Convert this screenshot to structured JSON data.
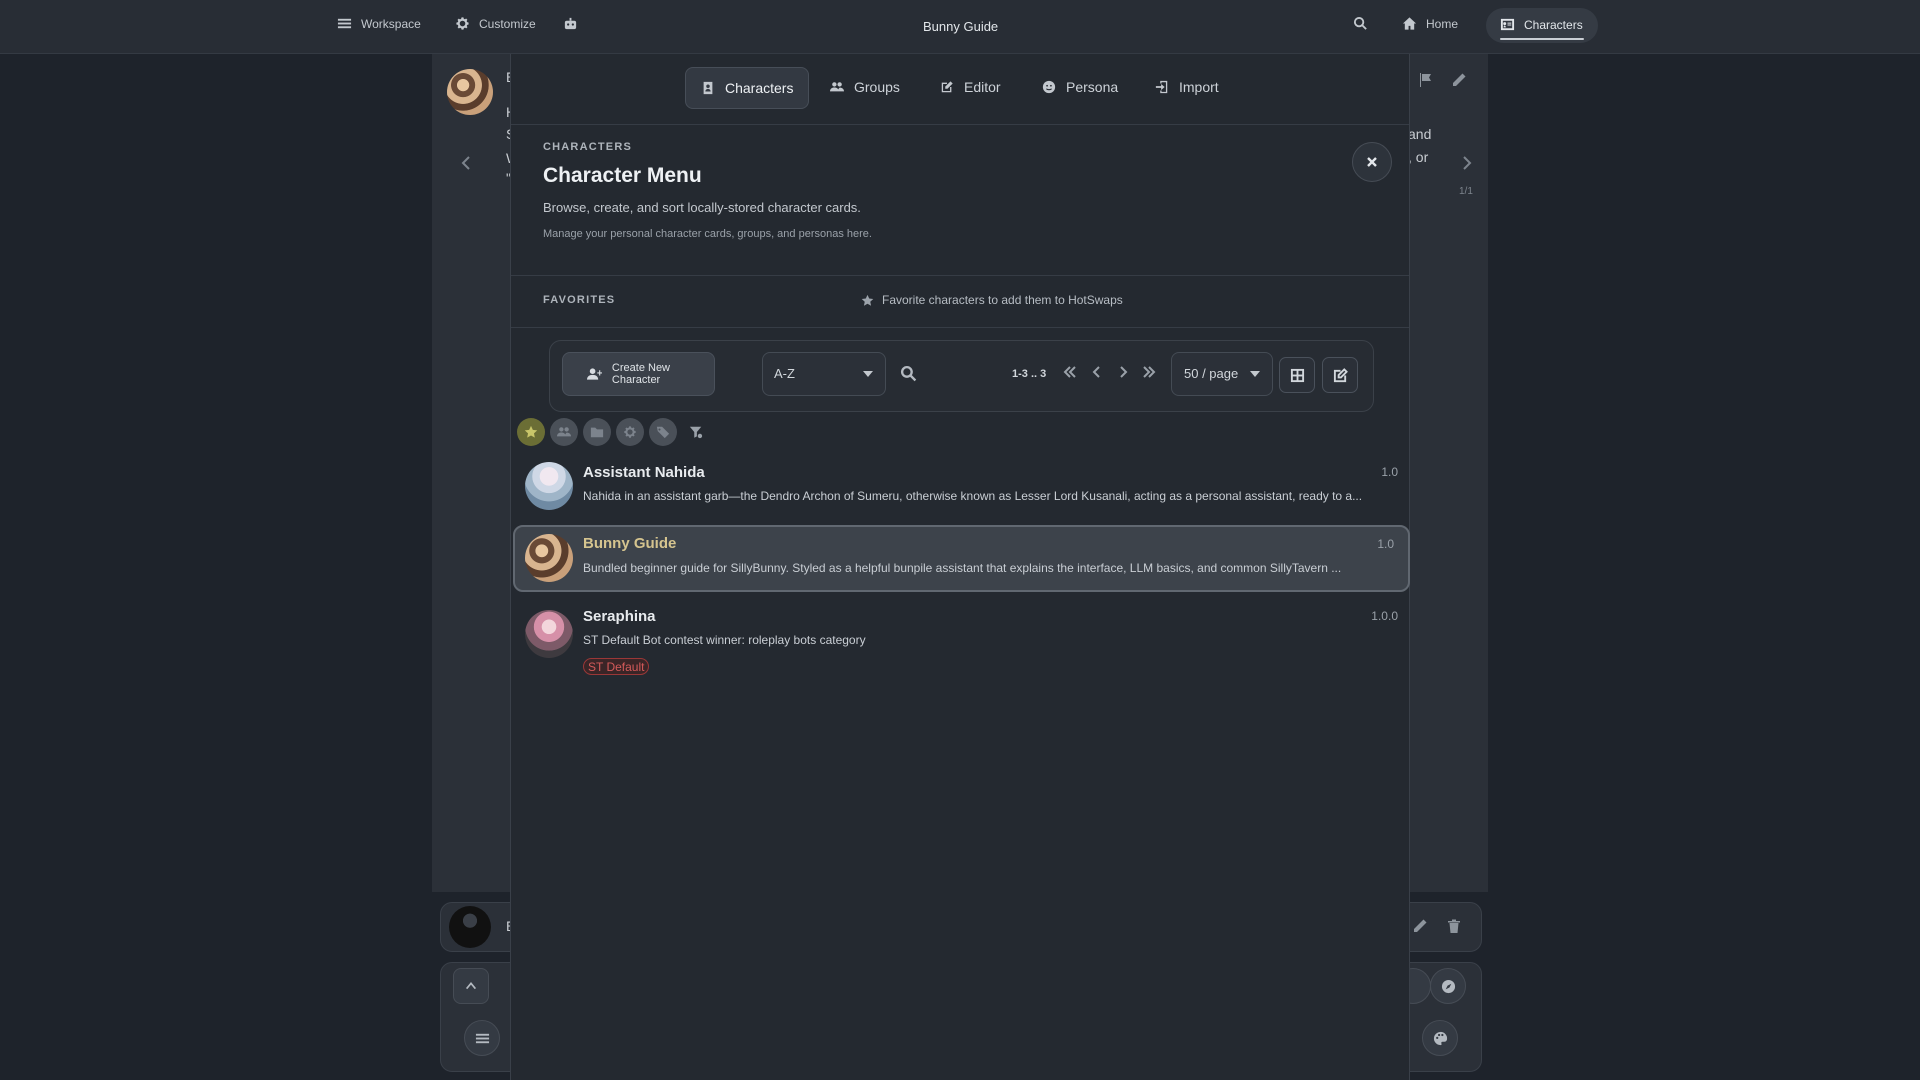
{
  "topbar": {
    "workspace_label": "Workspace",
    "customize_label": "Customize",
    "title": "Bunny Guide",
    "home_label": "Home",
    "characters_label": "Characters"
  },
  "background": {
    "char_initial": "E",
    "line_letters": [
      "H",
      "S",
      "W",
      "\""
    ],
    "right_text": [
      "and",
      ", or"
    ],
    "swipe_counter": "1/1",
    "composer_initial": "E"
  },
  "tabs": [
    {
      "label": "Characters",
      "icon": "address-book-icon"
    },
    {
      "label": "Groups",
      "icon": "users-icon"
    },
    {
      "label": "Editor",
      "icon": "edit-icon"
    },
    {
      "label": "Persona",
      "icon": "face-icon"
    },
    {
      "label": "Import",
      "icon": "import-icon"
    }
  ],
  "header": {
    "section": "CHARACTERS",
    "title": "Character Menu",
    "description": "Browse, create, and sort locally-stored character cards.",
    "subtext": "Manage your personal character cards, groups, and personas here."
  },
  "favorites": {
    "label": "FAVORITES",
    "hint": "Favorite characters to add them to HotSwaps"
  },
  "toolbar": {
    "create_label": "Create New Character",
    "sort_value": "A-Z",
    "pager_info": "1-3 .. 3",
    "per_page_value": "50 / page"
  },
  "characters": [
    {
      "name": "Assistant Nahida",
      "description": "Nahida in an assistant garb—the Dendro Archon of Sumeru, otherwise known as Lesser Lord Kusanali, acting as a personal assistant, ready to a...",
      "version": "1.0"
    },
    {
      "name": "Bunny Guide",
      "description": "Bundled beginner guide for SillyBunny. Styled as a helpful bunpile assistant that explains the interface, LLM basics, and common SillyTavern ...",
      "version": "1.0",
      "selected": true
    },
    {
      "name": "Seraphina",
      "description": "ST Default Bot contest winner: roleplay bots category",
      "version": "1.0.0",
      "tag": "ST Default"
    }
  ],
  "colors": {
    "background": "#1e232b",
    "panel": "#242930",
    "selected_row": "#3d434b",
    "favorite_chip": "#6b6e35",
    "selected_name": "#d5c48f",
    "tag_text": "#d45a5a"
  }
}
